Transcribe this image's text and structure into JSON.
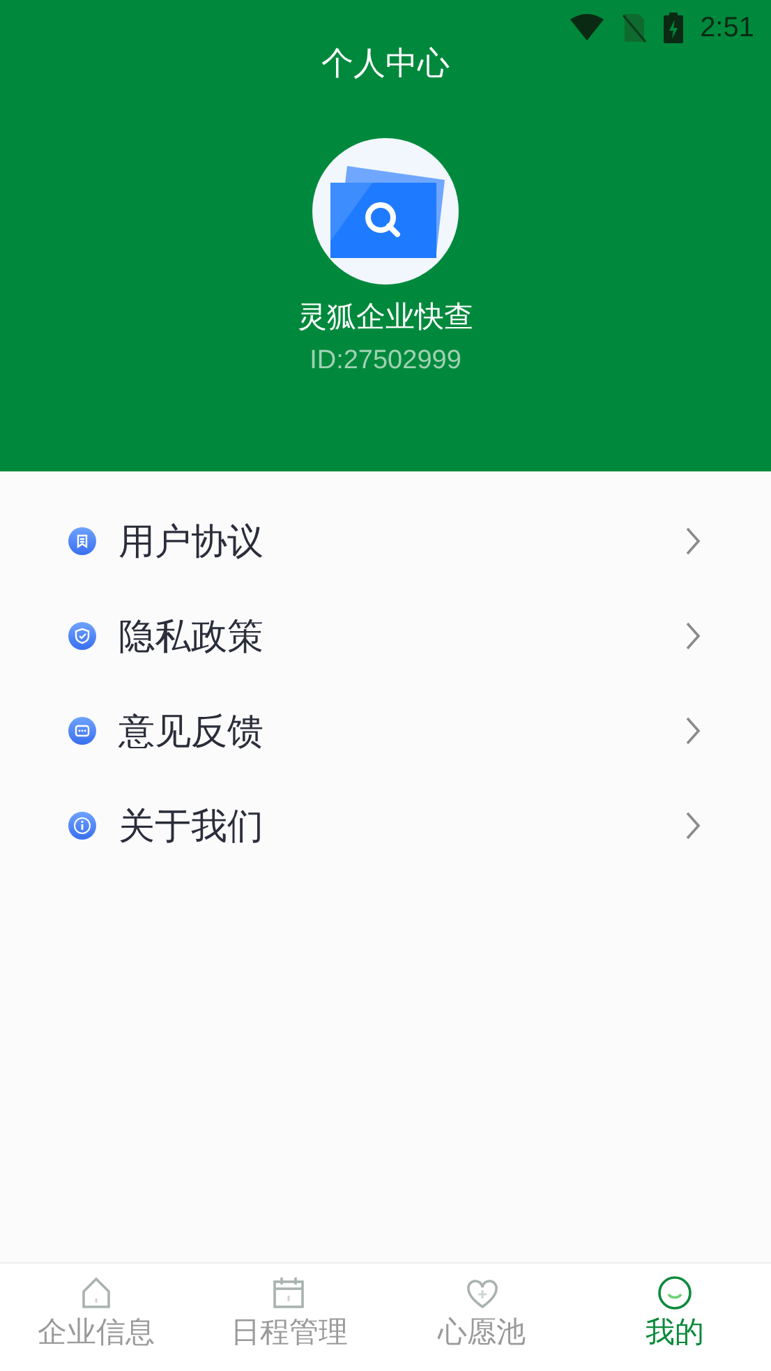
{
  "status_bar": {
    "time": "2:51"
  },
  "header": {
    "title": "个人中心",
    "app_name": "灵狐企业快查",
    "user_id": "ID:27502999"
  },
  "menu": [
    {
      "kind": "document",
      "label": "用户协议"
    },
    {
      "kind": "shield",
      "label": "隐私政策"
    },
    {
      "kind": "chat",
      "label": "意见反馈"
    },
    {
      "kind": "info",
      "label": "关于我们"
    }
  ],
  "tabs": [
    {
      "kind": "home",
      "label": "企业信息",
      "selected": false
    },
    {
      "kind": "calendar",
      "label": "日程管理",
      "selected": false
    },
    {
      "kind": "heart",
      "label": "心愿池",
      "selected": false
    },
    {
      "kind": "smile",
      "label": "我的",
      "selected": true
    }
  ]
}
